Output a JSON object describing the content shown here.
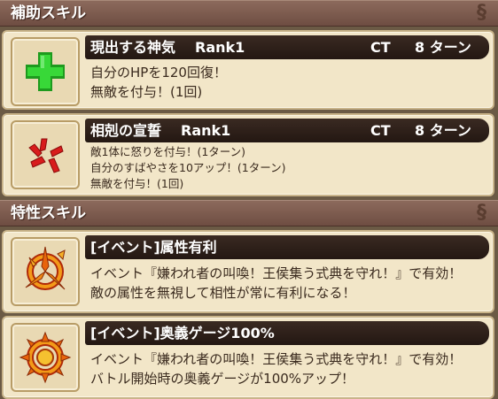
{
  "sections": {
    "support_title": "補助スキル",
    "trait_title": "特性スキル"
  },
  "skills": [
    {
      "name": "現出する神気",
      "rank": "Rank1",
      "ct_label": "CT",
      "turns": "8 ターン",
      "icon": "green-cross-heal-icon",
      "lines": [
        "自分のHPを120回復！",
        "無敵を付与！(1回)"
      ]
    },
    {
      "name": "相剋の宣誓",
      "rank": "Rank1",
      "ct_label": "CT",
      "turns": "8 ターン",
      "icon": "anger-mark-icon",
      "lines": [
        "敵1体に怒りを付与！(1ターン)",
        "自分のすばやさを10アップ！(1ターン)",
        "無敵を付与！(1回)"
      ]
    }
  ],
  "traits": [
    {
      "name": "[イベント]属性有利",
      "icon": "element-advantage-icon",
      "lines": [
        "イベント『嫌われ者の叫喚！王侯集う式典を守れ！』で有効！",
        "敵の属性を無視して相性が常に有利になる！"
      ]
    },
    {
      "name": "[イベント]奥義ゲージ100%",
      "icon": "ougi-gauge-icon",
      "lines": [
        "イベント『嫌われ者の叫喚！王侯集う式典を守れ！』で有効！",
        "バトル開始時の奥義ゲージが100%アップ！"
      ]
    }
  ],
  "colors": {
    "header_bg": "#7a5a4c",
    "card_bg": "#f2e6c8",
    "title_bar": "#2c1e18",
    "heal_green": "#2ecc2e",
    "anger_red": "#d81c1c",
    "trait_orange": "#f07a10"
  }
}
